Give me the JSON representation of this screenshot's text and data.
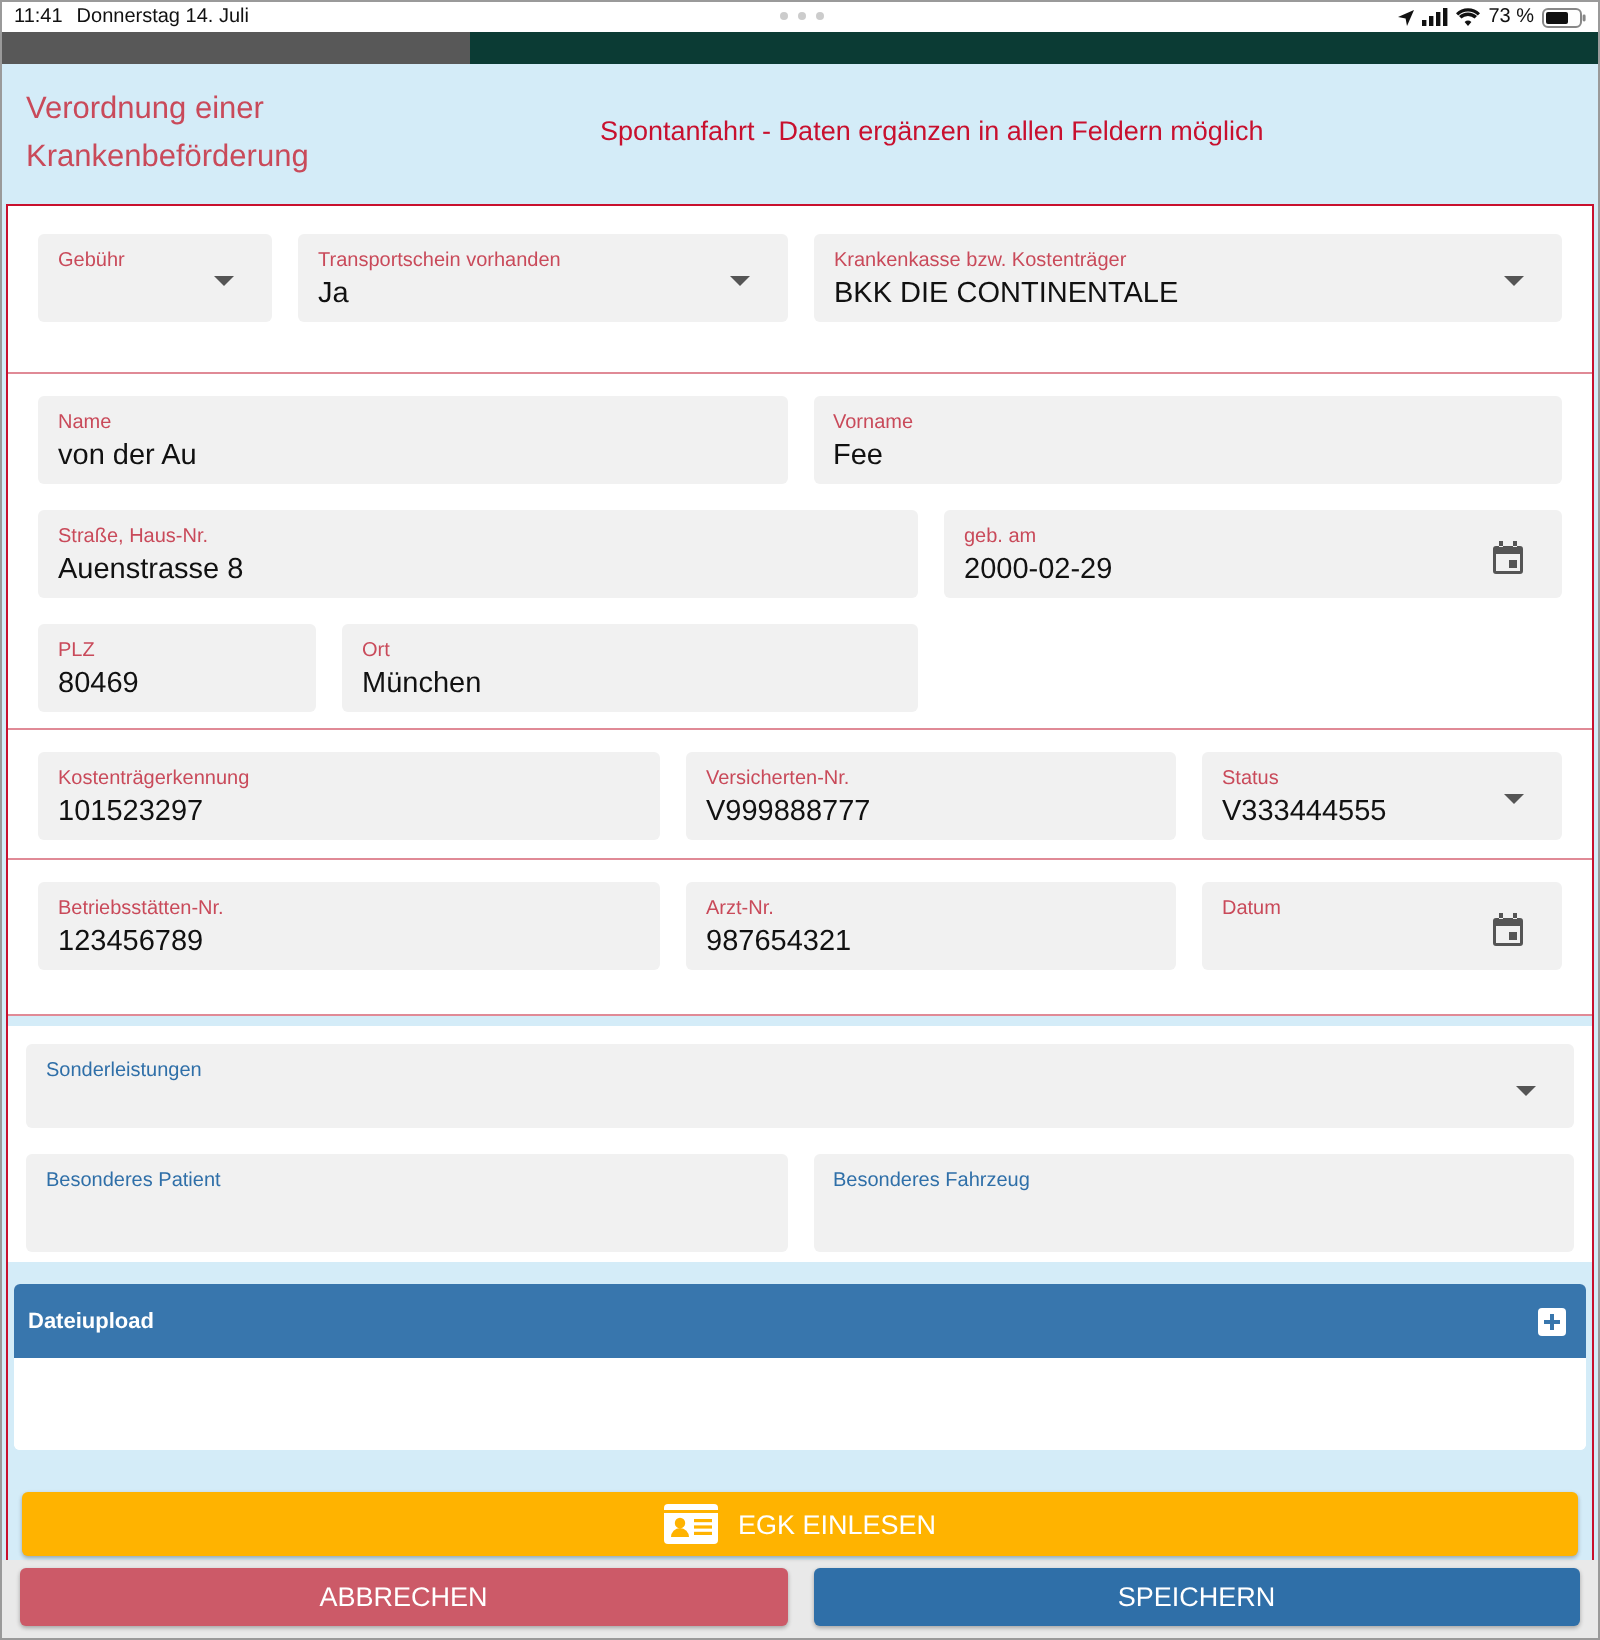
{
  "status_bar": {
    "time": "11:41",
    "date": "Donnerstag 14. Juli",
    "battery": "73 %"
  },
  "header": {
    "title": "Verordnung einer Krankenbeförderung",
    "notice": "Spontanfahrt - Daten ergänzen in allen Feldern möglich"
  },
  "sections": [
    {
      "color": "#c94a5a",
      "rows": [
        [
          {
            "label": "Gebühr",
            "kind": "select"
          },
          {
            "label": "Transportschein vorhanden",
            "value": "Ja",
            "kind": "select"
          },
          {
            "label": "Krankenkasse bzw. Kostenträger",
            "value": "BKK DIE CONTINENTALE",
            "kind": "select"
          }
        ]
      ]
    },
    {
      "color": "#c94a5a",
      "rows": [
        [
          {
            "label": "Name",
            "value": "von der Au",
            "kind": "text"
          },
          {
            "label": "Vorname",
            "value": "Fee",
            "kind": "text"
          }
        ],
        [
          {
            "label": "Straße, Haus-Nr.",
            "value": "Auenstrasse 8",
            "kind": "text"
          },
          {
            "label": "geb. am",
            "value": "2000-02-29",
            "kind": "date"
          }
        ],
        [
          {
            "label": "PLZ",
            "value": "80469",
            "kind": "text"
          },
          {
            "label": "Ort",
            "value": "München",
            "kind": "text"
          }
        ]
      ]
    },
    {
      "color": "#c94a5a",
      "rows": [
        [
          {
            "label": "Kostenträgerkennung",
            "value": "101523297",
            "kind": "text"
          },
          {
            "label": "Versicherten-Nr.",
            "value": "V999888777",
            "kind": "text"
          },
          {
            "label": "Status",
            "value": "V333444555",
            "kind": "select"
          }
        ]
      ]
    },
    {
      "color": "#c94a5a",
      "rows": [
        [
          {
            "label": "Betriebsstätten-Nr.",
            "value": "123456789",
            "kind": "text"
          },
          {
            "label": "Arzt-Nr.",
            "value": "987654321",
            "kind": "text"
          },
          {
            "label": "Datum",
            "kind": "date"
          }
        ]
      ]
    },
    {
      "color": "#2f6fa8",
      "rows": [
        [
          {
            "label": "Sonderleistungen",
            "kind": "select"
          }
        ],
        [
          {
            "label": "Besonderes Patient",
            "kind": "text"
          },
          {
            "label": "Besonderes Fahrzeug",
            "kind": "text"
          }
        ]
      ]
    }
  ],
  "upload": {
    "title": "Dateiupload"
  },
  "buttons": [
    {
      "label": "EGK EINLESEN",
      "kind": "card"
    },
    {
      "label": "ABBRECHEN",
      "kind": "cancel"
    },
    {
      "label": "SPEICHERN",
      "kind": "save"
    }
  ]
}
